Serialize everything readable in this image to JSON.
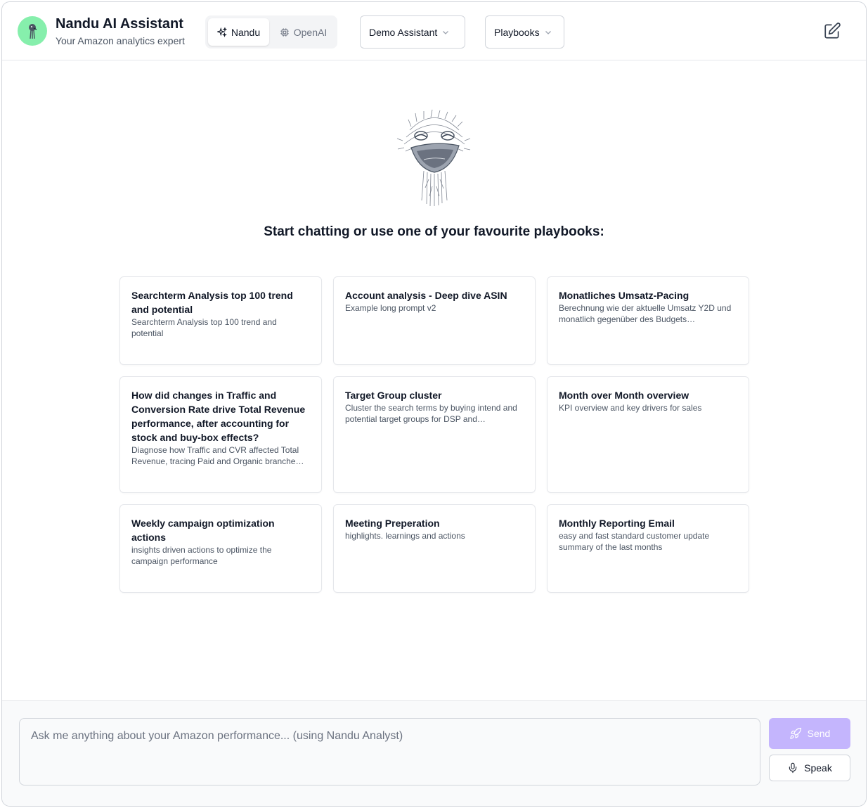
{
  "header": {
    "title": "Nandu AI Assistant",
    "subtitle": "Your Amazon analytics expert",
    "engine_toggle": [
      {
        "label": "Nandu",
        "icon": "sparkles-icon",
        "active": true
      },
      {
        "label": "OpenAI",
        "icon": "chip-icon",
        "active": false
      }
    ],
    "assistant_dropdown": "Demo Assistant",
    "playbooks_dropdown": "Playbooks"
  },
  "main": {
    "headline": "Start chatting or use one of your favourite playbooks:",
    "playbooks": [
      {
        "title": "Searchterm Analysis top 100 trend and potential",
        "description": "Searchterm Analysis top 100 trend and potential"
      },
      {
        "title": "Account analysis - Deep dive ASIN",
        "description": "Example long prompt v2"
      },
      {
        "title": "Monatliches Umsatz-Pacing",
        "description": "Berechnung wie der aktuelle Umsatz Y2D und monatlich gegenüber des Budgets…"
      },
      {
        "title": "How did changes in Traffic and Conversion Rate drive Total Revenue performance, after accounting for stock and buy-box effects?",
        "description": "Diagnose how Traffic and CVR affected Total Revenue, tracing Paid and Organic branche…"
      },
      {
        "title": "Target Group cluster",
        "description": "Cluster the search terms by buying intend and potential target groups for DSP and…"
      },
      {
        "title": "Month over Month overview",
        "description": "KPI overview and key drivers for sales"
      },
      {
        "title": "Weekly campaign optimization actions",
        "description": "insights driven actions to optimize the campaign performance"
      },
      {
        "title": "Meeting Preperation",
        "description": "highlights. learnings and actions"
      },
      {
        "title": "Monthly Reporting Email",
        "description": "easy and fast standard customer update summary of the last months"
      }
    ]
  },
  "composer": {
    "placeholder": "Ask me anything about your Amazon performance... (using Nandu Analyst)",
    "send_label": "Send",
    "speak_label": "Speak"
  },
  "colors": {
    "accent": "#c4b5fd",
    "avatar_bg": "#86efac"
  }
}
